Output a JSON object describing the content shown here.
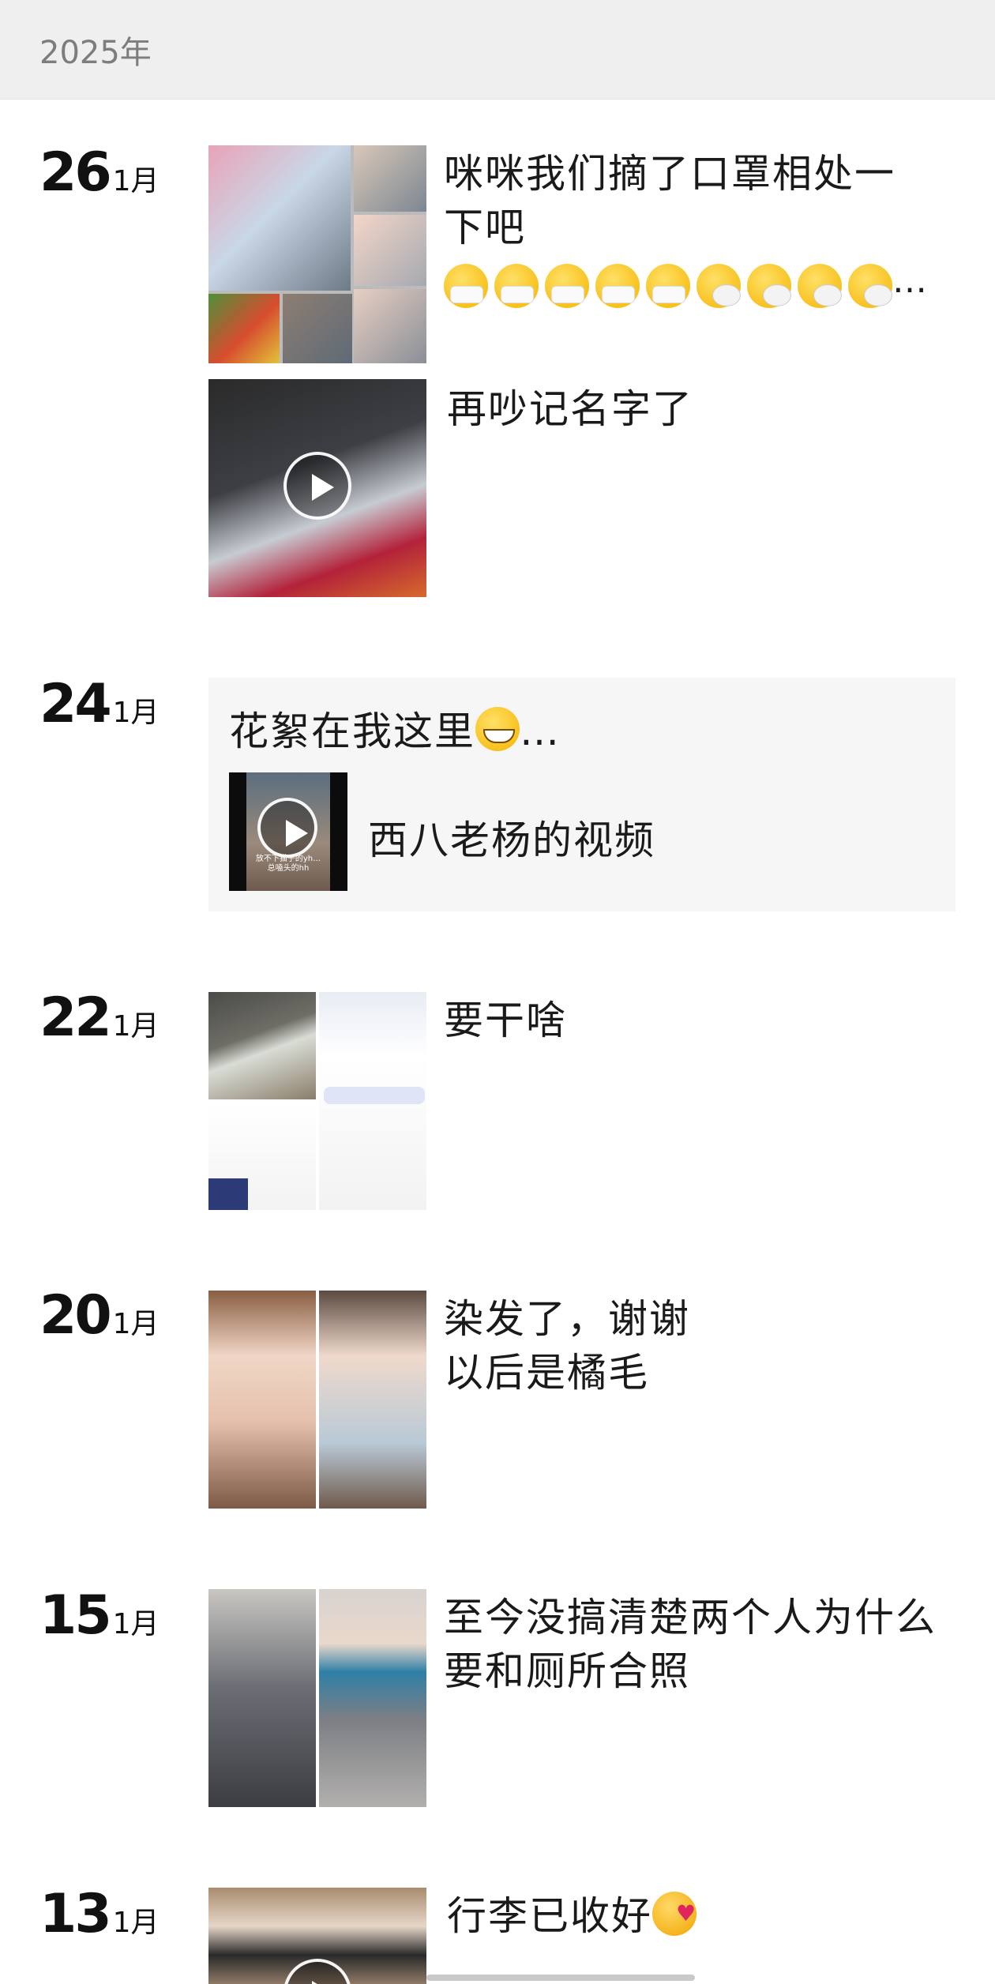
{
  "header": {
    "year": "2025年"
  },
  "posts": [
    {
      "day": "26",
      "month": "1月",
      "text": "咪咪我们摘了口罩相处一\n下吧"
    },
    {
      "text": "再吵记名字了"
    },
    {
      "day": "24",
      "month": "1月",
      "share_title": "花絮在我这里",
      "share_label": "西八老杨的视频",
      "share_thumb_caption": "放不下猫子的yh…\n总嗑头的hh"
    },
    {
      "day": "22",
      "month": "1月",
      "text": "要干啥"
    },
    {
      "day": "20",
      "month": "1月",
      "text": "染发了，谢谢\n以后是橘毛"
    },
    {
      "day": "15",
      "month": "1月",
      "text": "至今没搞清楚两个人为什么\n要和厕所合照"
    },
    {
      "day": "13",
      "month": "1月",
      "text": "行李已收好"
    }
  ],
  "ellipsis": "…",
  "emoji_row": [
    "mask",
    "mask",
    "mask",
    "mask",
    "mask",
    "sneeze",
    "sneeze",
    "sneeze",
    "sneeze"
  ],
  "colors": {
    "header_bg": "#efefef",
    "card_bg": "#f6f6f6",
    "text": "#1a1a1a",
    "year_text": "#7d7d7d"
  }
}
